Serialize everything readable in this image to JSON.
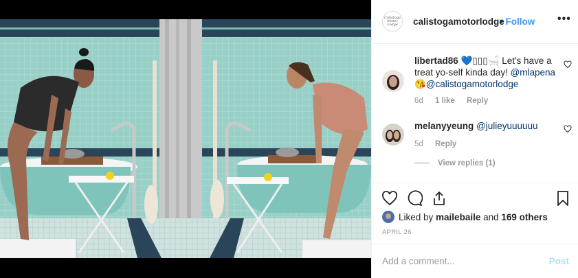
{
  "post": {
    "account_logo_text": "Calistoga Motor Lodge",
    "username": "calistogamotorlodge",
    "separator": "•",
    "follow_label": "Follow",
    "more_label": "•••"
  },
  "comments": [
    {
      "username": "libertad86",
      "emoji_text": "💙▯▯▯🛁",
      "text": " Let's have a treat yo-self kinda day! ",
      "mention1": "@mlapena",
      "emoji2": "😘",
      "mention2": "@calistogamotorlodge",
      "age": "6d",
      "likes": "1 like",
      "reply_label": "Reply"
    },
    {
      "username": "melanyyeung",
      "mention1": "@julieyuuuuuu",
      "age": "5d",
      "reply_label": "Reply"
    }
  ],
  "view_replies": "View replies (1)",
  "icons": {
    "like": "heart-icon",
    "comment": "comment-icon",
    "share": "share-icon",
    "save": "bookmark-icon"
  },
  "likes": {
    "prefix": "Liked by ",
    "user": "mailebaile",
    "middle": " and ",
    "others": "169 others"
  },
  "date": "APRIL 26",
  "add_comment": {
    "placeholder": "Add a comment...",
    "post_label": "Post"
  },
  "colors": {
    "link_blue": "#3897f0",
    "post_disabled": "#b2dffc",
    "tile_teal": "#9fd3cc",
    "muted": "#999999"
  }
}
